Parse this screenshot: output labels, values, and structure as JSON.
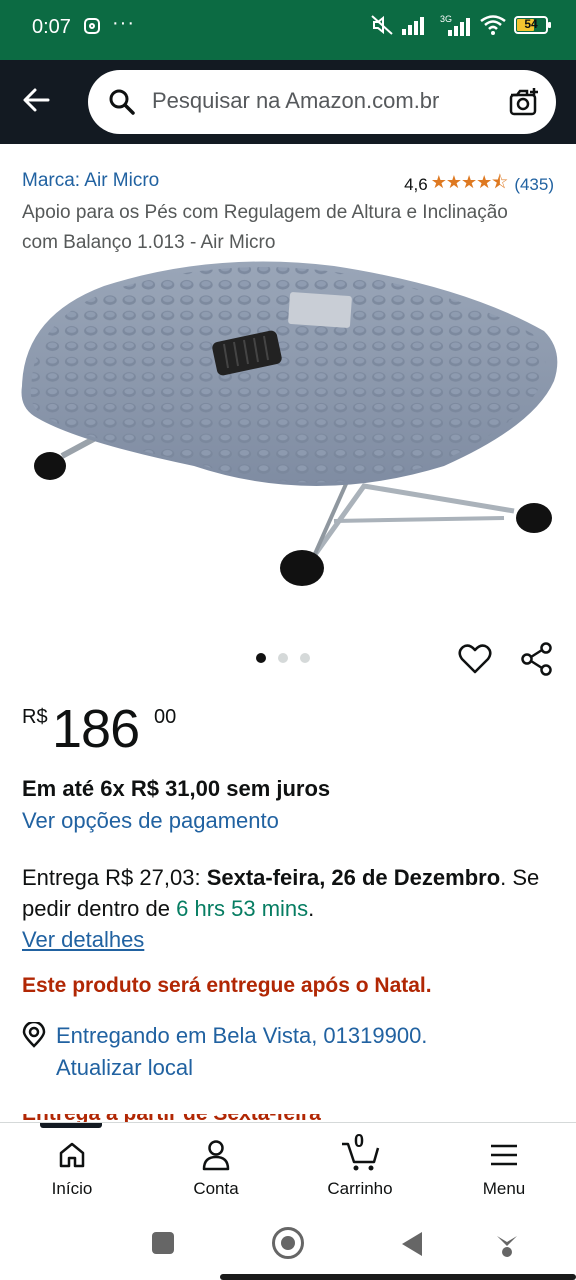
{
  "status_bar": {
    "time": "0:07",
    "battery": "54",
    "network": "3G"
  },
  "search": {
    "placeholder": "Pesquisar na Amazon.com.br"
  },
  "product": {
    "brand": "Marca: Air Micro",
    "rating_value": "4,6",
    "stars": "★★★★⯪",
    "rating_count": "(435)",
    "title": "Apoio para os Pés com Regulagem de Altura e Inclinação com Balanço 1.013 - Air Micro",
    "image_count": 3,
    "active_image": 1
  },
  "price": {
    "currency": "R$",
    "whole": "186",
    "cents": "00"
  },
  "installments": "Em até 6x R$ 31,00 sem juros",
  "payment_link": "Ver opções de pagamento",
  "delivery": {
    "prefix": "Entrega R$ 27,03: ",
    "date": "Sexta-feira, 26 de Dezembro",
    "middle": ". Se pedir dentro de ",
    "countdown": "6 hrs 53 mins",
    "suffix": ".",
    "details_link": "Ver detalhes"
  },
  "christmas_notice": "Este produto será entregue após o Natal.",
  "location": {
    "text": "Entregando em Bela Vista, 01319900.",
    "update_link": "Atualizar local"
  },
  "partial_text": "Entrega a partir de Sexta-feira",
  "bottom_nav": {
    "home": "Início",
    "account": "Conta",
    "cart": "Carrinho",
    "cart_count": "0",
    "menu": "Menu"
  },
  "colors": {
    "header_bg": "#131a22",
    "status_bg": "#0c6b43",
    "link": "#2162a1",
    "star": "#de7921",
    "alert": "#b12704",
    "green": "#067d62"
  }
}
